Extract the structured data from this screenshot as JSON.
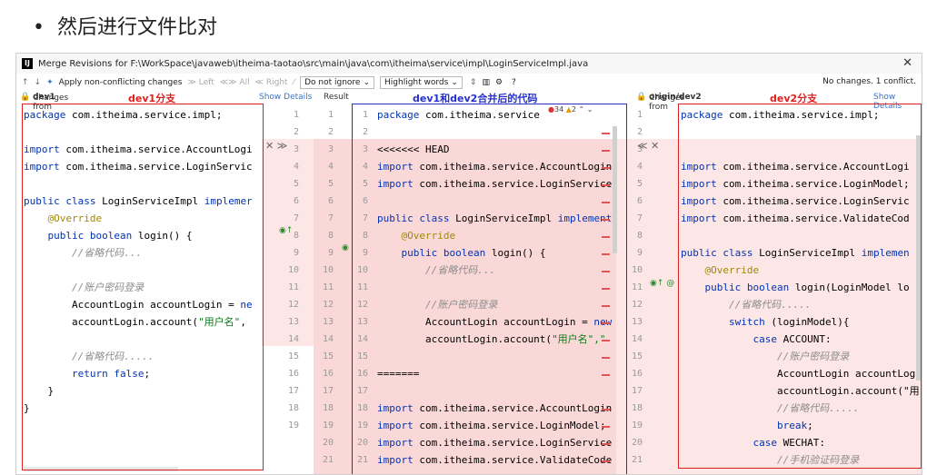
{
  "slide": {
    "bullet": "•",
    "title": "然后进行文件比对"
  },
  "window": {
    "title": "Merge Revisions for F:\\WorkSpace\\javaweb\\itheima-taotao\\src\\main\\java\\com\\itheima\\service\\impl\\LoginServiceImpl.java",
    "close": "✕"
  },
  "toolbar": {
    "apply_label": "Apply non-conflicting changes",
    "left_label": "Left",
    "all_label": "All",
    "right_label": "Right",
    "ignore_value": "Do not ignore",
    "highlight_value": "Highlight words",
    "help": "?",
    "status": "No changes. 1 conflict."
  },
  "headers": {
    "left": "Changes from",
    "left_branch": "dev1",
    "left_annot": "dev1分支",
    "show_details": "Show Details",
    "result": "Result",
    "center_annot": "dev1和dev2合并后的代码",
    "right": "Changes from",
    "right_branch": "origin/dev2",
    "right_annot": "dev2分支",
    "show_details_right": "Show Details"
  },
  "center_inspections": {
    "errors": "34",
    "warnings": "2"
  },
  "left_lines": [
    [
      {
        "t": "package",
        "c": "kw"
      },
      {
        "t": " com.itheima.service.impl;"
      }
    ],
    [],
    [
      {
        "t": "import",
        "c": "kw"
      },
      {
        "t": " com.itheima.service.AccountLogi"
      }
    ],
    [
      {
        "t": "import",
        "c": "kw"
      },
      {
        "t": " com.itheima.service.LoginServic"
      }
    ],
    [],
    [
      {
        "t": "public class",
        "c": "kw"
      },
      {
        "t": " LoginServiceImpl "
      },
      {
        "t": "implemer",
        "c": "kw"
      }
    ],
    [
      {
        "t": "    "
      },
      {
        "t": "@Override",
        "c": "an"
      }
    ],
    [
      {
        "t": "    "
      },
      {
        "t": "public boolean",
        "c": "kw"
      },
      {
        "t": " login() {"
      }
    ],
    [
      {
        "t": "        "
      },
      {
        "t": "//省略代码...",
        "c": "cm"
      }
    ],
    [],
    [
      {
        "t": "        "
      },
      {
        "t": "//账户密码登录",
        "c": "cm"
      }
    ],
    [
      {
        "t": "        AccountLogin accountLogin = "
      },
      {
        "t": "ne",
        "c": "kw"
      }
    ],
    [
      {
        "t": "        accountLogin.account("
      },
      {
        "t": "\"用户名\"",
        "c": "st"
      },
      {
        "t": ","
      }
    ],
    [],
    [
      {
        "t": "        "
      },
      {
        "t": "//省略代码.....",
        "c": "cm"
      }
    ],
    [
      {
        "t": "        "
      },
      {
        "t": "return false",
        "c": "kw"
      },
      {
        "t": ";"
      }
    ],
    [
      {
        "t": "    }"
      }
    ],
    [
      {
        "t": "}"
      }
    ],
    [],
    [],
    []
  ],
  "center_lines": [
    [
      {
        "t": "package",
        "c": "kw"
      },
      {
        "t": " com.itheima.service"
      }
    ],
    [],
    [
      {
        "t": "<<<<<<< HEAD"
      }
    ],
    [
      {
        "t": "import",
        "c": "kw"
      },
      {
        "t": " com.itheima.service.AccountLogin"
      }
    ],
    [
      {
        "t": "import",
        "c": "kw"
      },
      {
        "t": " com.itheima.service.LoginService"
      }
    ],
    [],
    [
      {
        "t": "public class",
        "c": "kw"
      },
      {
        "t": " LoginServiceImpl "
      },
      {
        "t": "implement",
        "c": "kw"
      }
    ],
    [
      {
        "t": "    "
      },
      {
        "t": "@Override",
        "c": "an"
      }
    ],
    [
      {
        "t": "    "
      },
      {
        "t": "public boolean",
        "c": "kw"
      },
      {
        "t": " login() {"
      }
    ],
    [
      {
        "t": "        "
      },
      {
        "t": "//省略代码...",
        "c": "cm"
      }
    ],
    [],
    [
      {
        "t": "        "
      },
      {
        "t": "//账户密码登录",
        "c": "cm"
      }
    ],
    [
      {
        "t": "        AccountLogin accountLogin = "
      },
      {
        "t": "new",
        "c": "kw"
      }
    ],
    [
      {
        "t": "        accountLogin.account("
      },
      {
        "t": "\"用户名\",\"",
        "c": "st"
      }
    ],
    [],
    [
      {
        "t": "======="
      }
    ],
    [],
    [
      {
        "t": "import",
        "c": "kw"
      },
      {
        "t": " com.itheima.service.AccountLogin"
      }
    ],
    [
      {
        "t": "import",
        "c": "kw"
      },
      {
        "t": " com.itheima.service.LoginModel;"
      }
    ],
    [
      {
        "t": "import",
        "c": "kw"
      },
      {
        "t": " com.itheima.service.LoginService"
      }
    ],
    [
      {
        "t": "import",
        "c": "kw"
      },
      {
        "t": " com.itheima.service.ValidateCode"
      }
    ]
  ],
  "right_lines": [
    [
      {
        "t": "package",
        "c": "kw"
      },
      {
        "t": " com.itheima.service.impl;"
      }
    ],
    [],
    [],
    [
      {
        "t": "import",
        "c": "kw"
      },
      {
        "t": " com.itheima.service.AccountLogi"
      }
    ],
    [
      {
        "t": "import",
        "c": "kw"
      },
      {
        "t": " com.itheima.service.LoginModel;"
      }
    ],
    [
      {
        "t": "import",
        "c": "kw"
      },
      {
        "t": " com.itheima.service.LoginServic"
      }
    ],
    [
      {
        "t": "import",
        "c": "kw"
      },
      {
        "t": " com.itheima.service.ValidateCod"
      }
    ],
    [],
    [
      {
        "t": "public class",
        "c": "kw"
      },
      {
        "t": " LoginServiceImpl "
      },
      {
        "t": "implemen",
        "c": "kw"
      }
    ],
    [
      {
        "t": "    "
      },
      {
        "t": "@Override",
        "c": "an"
      }
    ],
    [
      {
        "t": "    "
      },
      {
        "t": "public boolean",
        "c": "kw"
      },
      {
        "t": " login(LoginModel lo"
      }
    ],
    [
      {
        "t": "        "
      },
      {
        "t": "//省略代码.....",
        "c": "cm"
      }
    ],
    [
      {
        "t": "        "
      },
      {
        "t": "switch",
        "c": "kw"
      },
      {
        "t": " (loginModel){"
      }
    ],
    [
      {
        "t": "            "
      },
      {
        "t": "case",
        "c": "kw"
      },
      {
        "t": " ACCOUNT:"
      }
    ],
    [
      {
        "t": "                "
      },
      {
        "t": "//账户密码登录",
        "c": "cm"
      }
    ],
    [
      {
        "t": "                AccountLogin accountLog"
      }
    ],
    [
      {
        "t": "                accountLogin.account(\"用"
      }
    ],
    [
      {
        "t": "                "
      },
      {
        "t": "//省略代码.....",
        "c": "cm"
      }
    ],
    [
      {
        "t": "                "
      },
      {
        "t": "break",
        "c": "kw"
      },
      {
        "t": ";"
      }
    ],
    [
      {
        "t": "            "
      },
      {
        "t": "case",
        "c": "kw"
      },
      {
        "t": " WECHAT:"
      }
    ],
    [
      {
        "t": "                "
      },
      {
        "t": "//手机验证码登录",
        "c": "cm"
      }
    ]
  ],
  "left_nums": [
    "1",
    "2",
    "3",
    "4",
    "5",
    "6",
    "7",
    "8",
    "9",
    "10",
    "11",
    "12",
    "13",
    "14",
    "15",
    "16",
    "17",
    "18",
    "19",
    "",
    ""
  ],
  "center_nums_a": [
    "1",
    "2",
    "3",
    "4",
    "5",
    "6",
    "7",
    "8",
    "9",
    "10",
    "11",
    "12",
    "13",
    "14",
    "15",
    "16",
    "17",
    "18",
    "19",
    "20",
    "21"
  ],
  "center_nums_b": [
    "1",
    "2",
    "3",
    "4",
    "5",
    "6",
    "7",
    "8",
    "9",
    "10",
    "11",
    "12",
    "13",
    "14",
    "15",
    "16",
    "17",
    "18",
    "19",
    "20",
    "21"
  ],
  "right_nums": [
    "1",
    "2",
    "3",
    "4",
    "5",
    "6",
    "7",
    "8",
    "9",
    "10",
    "11",
    "12",
    "13",
    "14",
    "15",
    "16",
    "17",
    "18",
    "19",
    "20",
    "21"
  ],
  "colors": {
    "red_frame": "#e02020",
    "blue_frame": "#2530c8",
    "conflict_bg": "#fbd8d8"
  }
}
